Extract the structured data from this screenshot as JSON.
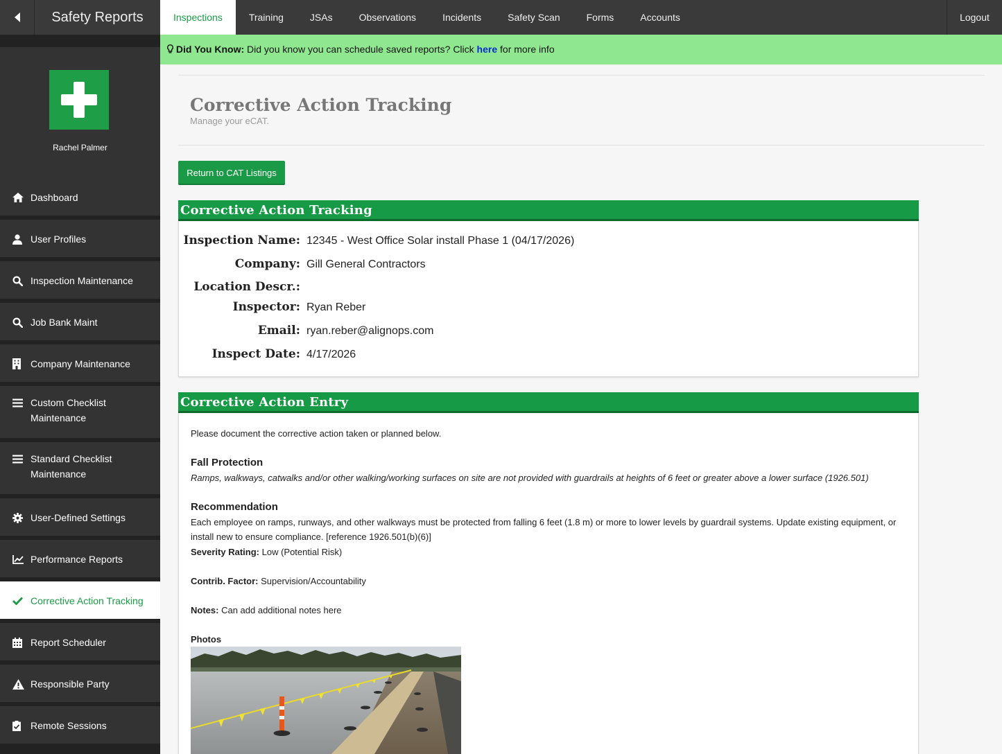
{
  "app": {
    "brand": "Safety Reports"
  },
  "topnav": {
    "tabs": [
      "Inspections",
      "Training",
      "JSAs",
      "Observations",
      "Incidents",
      "Safety Scan",
      "Forms",
      "Accounts"
    ],
    "active_tab": "Inspections",
    "logout": "Logout"
  },
  "banner": {
    "lead": "Did You Know:",
    "text": "Did you know you can schedule saved reports? Click",
    "link": "here",
    "tail": "for more info"
  },
  "profile": {
    "name": "Rachel Palmer"
  },
  "sidebar": {
    "items": [
      {
        "label": "Dashboard",
        "icon": "home-icon"
      },
      {
        "label": "User Profiles",
        "icon": "user-icon"
      },
      {
        "label": "Inspection Maintenance",
        "icon": "search-icon"
      },
      {
        "label": "Job Bank Maint",
        "icon": "search-icon"
      },
      {
        "label": "Company Maintenance",
        "icon": "building-icon"
      },
      {
        "label": "Custom Checklist Maintenance",
        "icon": "list-icon"
      },
      {
        "label": "Standard Checklist Maintenance",
        "icon": "list-icon"
      },
      {
        "label": "User-Defined Settings",
        "icon": "gear-icon"
      },
      {
        "label": "Performance Reports",
        "icon": "chart-icon"
      },
      {
        "label": "Corrective Action Tracking",
        "icon": "check-icon",
        "active": true
      },
      {
        "label": "Report Scheduler",
        "icon": "calendar-icon"
      },
      {
        "label": "Responsible Party",
        "icon": "warning-icon"
      },
      {
        "label": "Remote Sessions",
        "icon": "clipboard-check-icon"
      }
    ]
  },
  "page": {
    "title": "Corrective Action Tracking",
    "subtitle": "Manage your eCAT.",
    "return_button": "Return to CAT Listings"
  },
  "tracking": {
    "heading": "Corrective Action Tracking",
    "fields": [
      {
        "label": "Inspection Name:",
        "value": "12345 - West Office Solar install Phase 1 (04/17/2026)"
      },
      {
        "label": "Company:",
        "value": "Gill General Contractors"
      },
      {
        "label": "Location Descr.:",
        "value": ""
      },
      {
        "label": "Inspector:",
        "value": "Ryan Reber"
      },
      {
        "label": "Email:",
        "value": "ryan.reber@alignops.com"
      },
      {
        "label": "Inspect Date:",
        "value": "4/17/2026"
      }
    ]
  },
  "entry": {
    "heading": "Corrective Action Entry",
    "intro": "Please document the corrective action taken or planned below.",
    "item_title": "Fall Protection",
    "item_desc": "Ramps, walkways, catwalks and/or other walking/working surfaces on site are not provided with guardrails at heights of 6 feet or greater above a lower surface (1926.501)",
    "rec_title": "Recommendation",
    "rec_text": "Each employee on ramps, runways, and other walkways must be protected from falling 6 feet (1.8 m) or more to lower levels by guardrail systems. Update existing equipment, or install new to ensure compliance. [reference 1926.501(b)(6)]",
    "severity_label": "Severity Rating:",
    "severity_value": "Low (Potential Risk)",
    "contrib_label": "Contrib. Factor:",
    "contrib_value": "Supervision/Accountability",
    "notes_label": "Notes:",
    "notes_value": "Can add additional notes here",
    "photos_label": "Photos"
  },
  "colors": {
    "accent": "#1a9a46",
    "banner": "#8fe88f",
    "topbar": "#3a3a3a",
    "sidebar": "#333333"
  }
}
